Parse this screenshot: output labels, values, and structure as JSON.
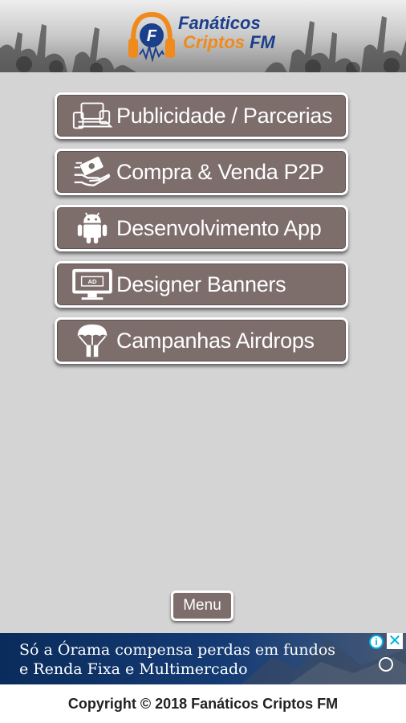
{
  "header": {
    "logo_line1": "Fanáticos",
    "logo_line2_a": "Criptos",
    "logo_line2_b": " FM"
  },
  "menu": {
    "items": [
      {
        "label": "Publicidade / Parcerias",
        "icon": "devices-icon"
      },
      {
        "label": "Compra & Venda P2P",
        "icon": "money-hand-icon"
      },
      {
        "label": "Desenvolvimento App",
        "icon": "android-icon"
      },
      {
        "label": "Designer Banners",
        "icon": "ad-monitor-icon"
      },
      {
        "label": "Campanhas Airdrops",
        "icon": "parachute-icon"
      }
    ],
    "menu_button_label": "Menu"
  },
  "ad": {
    "line1": "Só a Órama compensa perdas em fundos",
    "line2": "e Renda Fixa e Multimercado",
    "info_symbol": "i",
    "close_symbol": "✕"
  },
  "footer": {
    "copyright": "Copyright © 2018 Fanáticos Criptos FM"
  },
  "colors": {
    "button_bg": "#7d6e6c",
    "page_bg": "#d4d4d4",
    "logo_blue": "#1c3f8c",
    "logo_orange": "#f08a1c",
    "ad_bg": "#0a2c5c"
  }
}
